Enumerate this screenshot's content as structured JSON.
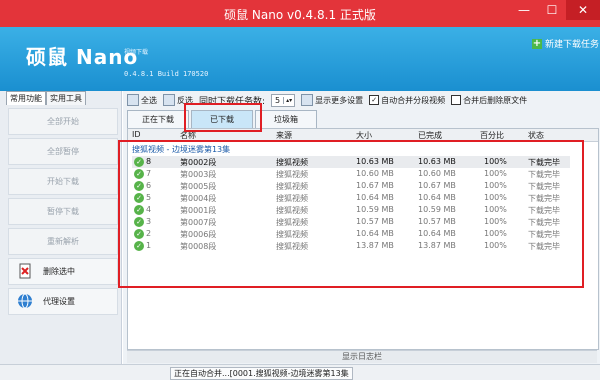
{
  "window": {
    "title": "硕鼠 Nano v0.4.8.1 正式版",
    "minimize": "—",
    "maximize": "☐",
    "close": "✕"
  },
  "header": {
    "logo_cn": "硕鼠",
    "logo_en": "Nano",
    "logo_sub": "视频下载",
    "version": "0.4.8.1 Build 170520",
    "new_task": "新建下载任务"
  },
  "sidebar": {
    "tabs": [
      "常用功能",
      "实用工具"
    ],
    "items": [
      {
        "label": "全部开始"
      },
      {
        "label": "全部暂停"
      },
      {
        "label": "开始下载"
      },
      {
        "label": "暂停下载"
      },
      {
        "label": "重新解析"
      },
      {
        "label": "删除选中"
      },
      {
        "label": "代理设置"
      }
    ]
  },
  "toolbar": {
    "select_all": "全选",
    "invert": "反选",
    "concurrent_label": "同时下载任务数:",
    "concurrent_value": "5",
    "more_settings": "显示更多设置",
    "auto_merge": "自动合并分段视频",
    "delete_after_merge": "合并后删除原文件"
  },
  "tabs": [
    "正在下载",
    "已下载",
    "垃圾箱"
  ],
  "table": {
    "headers": [
      "ID",
      "名称",
      "来源",
      "大小",
      "已完成",
      "百分比",
      "状态"
    ],
    "group": "搜狐视频 - 边境迷雾第13集",
    "rows": [
      {
        "id": "8",
        "name": "第0002段",
        "source": "搜狐视频",
        "size": "10.63 MB",
        "done": "10.63 MB",
        "percent": "100%",
        "status": "下载完毕"
      },
      {
        "id": "7",
        "name": "第0003段",
        "source": "搜狐视频",
        "size": "10.60 MB",
        "done": "10.60 MB",
        "percent": "100%",
        "status": "下载完毕"
      },
      {
        "id": "6",
        "name": "第0005段",
        "source": "搜狐视频",
        "size": "10.67 MB",
        "done": "10.67 MB",
        "percent": "100%",
        "status": "下载完毕"
      },
      {
        "id": "5",
        "name": "第0004段",
        "source": "搜狐视频",
        "size": "10.64 MB",
        "done": "10.64 MB",
        "percent": "100%",
        "status": "下载完毕"
      },
      {
        "id": "4",
        "name": "第0001段",
        "source": "搜狐视频",
        "size": "10.59 MB",
        "done": "10.59 MB",
        "percent": "100%",
        "status": "下载完毕"
      },
      {
        "id": "3",
        "name": "第0007段",
        "source": "搜狐视频",
        "size": "10.57 MB",
        "done": "10.57 MB",
        "percent": "100%",
        "status": "下载完毕"
      },
      {
        "id": "2",
        "name": "第0006段",
        "source": "搜狐视频",
        "size": "10.64 MB",
        "done": "10.64 MB",
        "percent": "100%",
        "status": "下载完毕"
      },
      {
        "id": "1",
        "name": "第0008段",
        "source": "搜狐视频",
        "size": "13.87 MB",
        "done": "13.87 MB",
        "percent": "100%",
        "status": "下载完毕"
      }
    ]
  },
  "log_bar": "显示日志栏",
  "status_text": "正在自动合并...[0001.搜狐视频-边境迷雾第13集",
  "colors": {
    "titlebar": "#e3343a",
    "header": "#2a9fdc",
    "highlight_box": "#e01e24",
    "done_icon": "#57b34a"
  }
}
